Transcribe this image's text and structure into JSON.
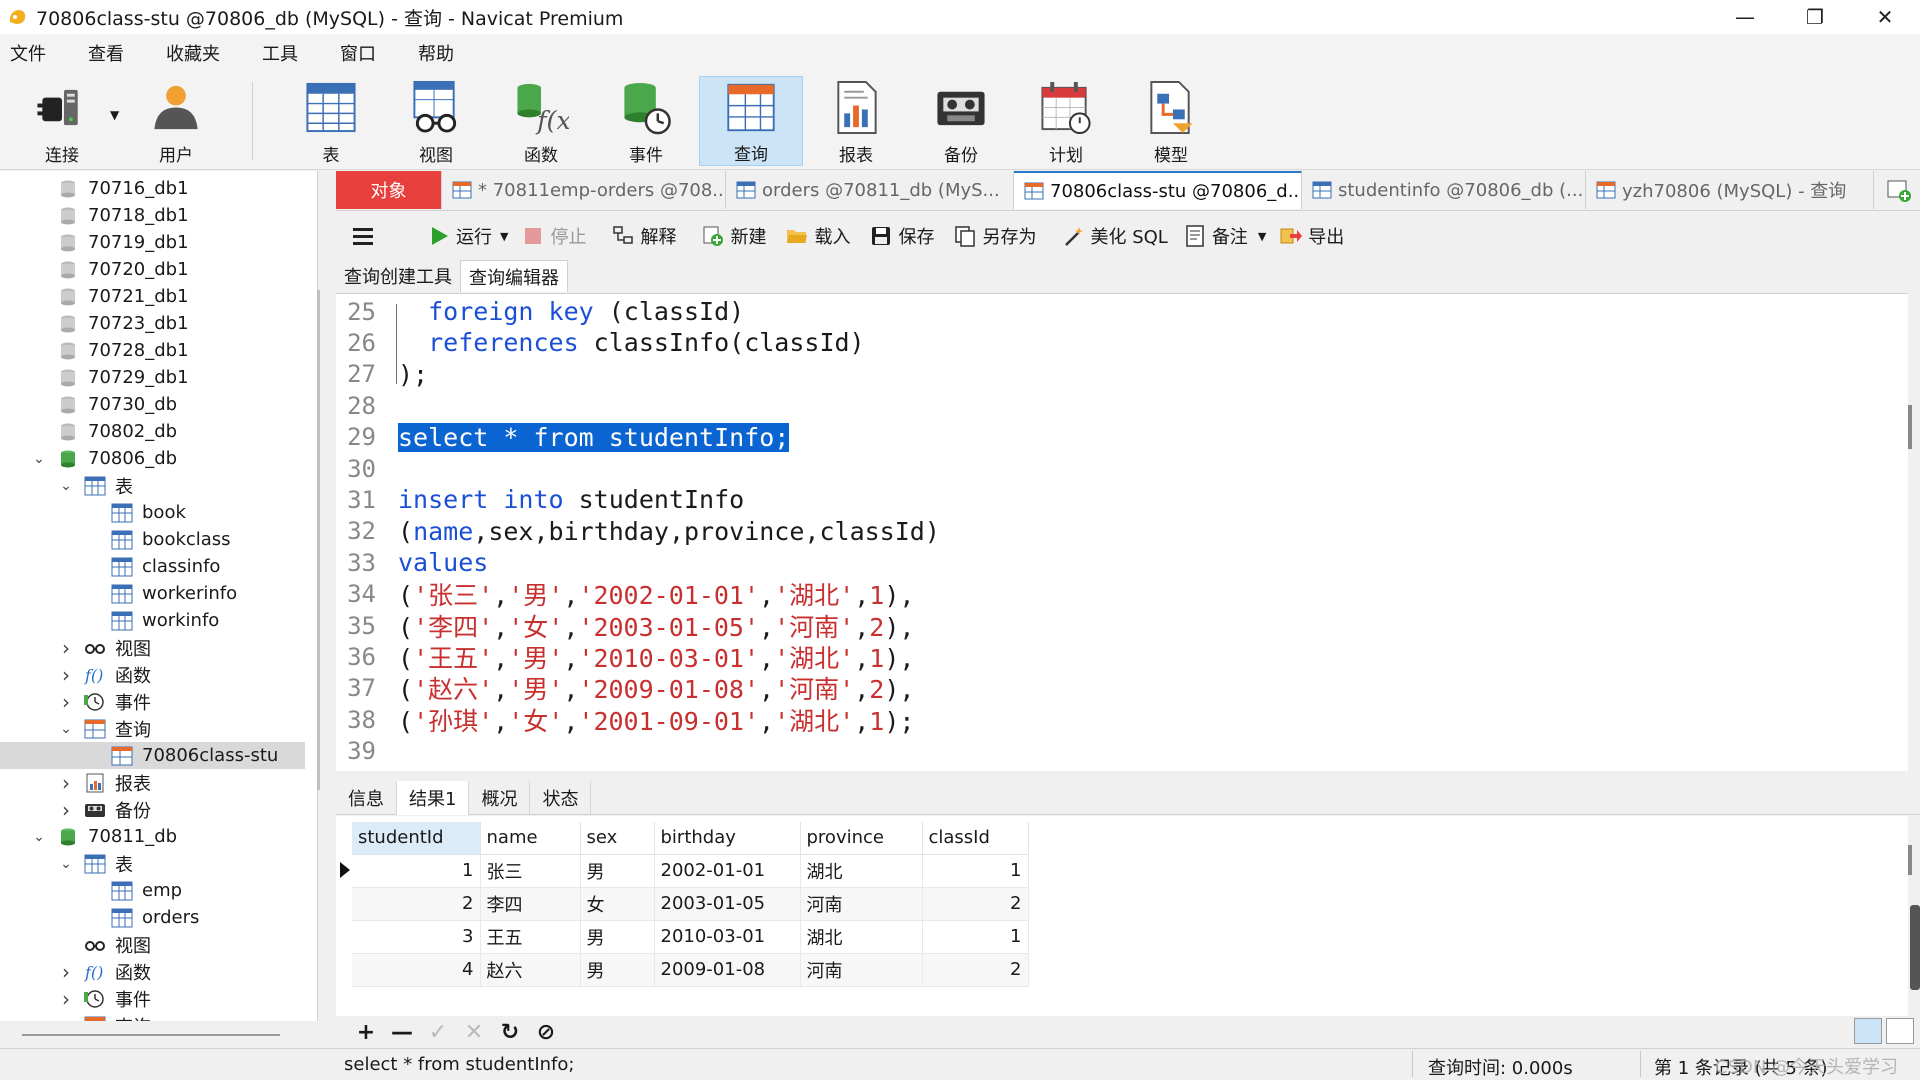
{
  "window": {
    "title": "70806class-stu @70806_db (MySQL) - 查询 - Navicat Premium",
    "minimize": "—",
    "restore": "❐",
    "close": "✕"
  },
  "menu": [
    "文件",
    "查看",
    "收藏夹",
    "工具",
    "窗口",
    "帮助"
  ],
  "toolbar": {
    "connect": "连接",
    "user": "用户",
    "table": "表",
    "view": "视图",
    "function": "函数",
    "event": "事件",
    "query": "查询",
    "report": "报表",
    "backup": "备份",
    "schedule": "计划",
    "model": "模型"
  },
  "tree": [
    {
      "label": "70716_db1",
      "type": "db",
      "level": 0,
      "chev": ""
    },
    {
      "label": "70718_db1",
      "type": "db",
      "level": 0,
      "chev": ""
    },
    {
      "label": "70719_db1",
      "type": "db",
      "level": 0,
      "chev": ""
    },
    {
      "label": "70720_db1",
      "type": "db",
      "level": 0,
      "chev": ""
    },
    {
      "label": "70721_db1",
      "type": "db",
      "level": 0,
      "chev": ""
    },
    {
      "label": "70723_db1",
      "type": "db",
      "level": 0,
      "chev": ""
    },
    {
      "label": "70728_db1",
      "type": "db",
      "level": 0,
      "chev": ""
    },
    {
      "label": "70729_db1",
      "type": "db",
      "level": 0,
      "chev": ""
    },
    {
      "label": "70730_db",
      "type": "db",
      "level": 0,
      "chev": ""
    },
    {
      "label": "70802_db",
      "type": "db",
      "level": 0,
      "chev": ""
    },
    {
      "label": "70806_db",
      "type": "dbopen",
      "level": 0,
      "chev": "v"
    },
    {
      "label": "表",
      "type": "tables",
      "level": 1,
      "chev": "v"
    },
    {
      "label": "book",
      "type": "table",
      "level": 2,
      "chev": ""
    },
    {
      "label": "bookclass",
      "type": "table",
      "level": 2,
      "chev": ""
    },
    {
      "label": "classinfo",
      "type": "table",
      "level": 2,
      "chev": ""
    },
    {
      "label": "workerinfo",
      "type": "table",
      "level": 2,
      "chev": ""
    },
    {
      "label": "workinfo",
      "type": "table",
      "level": 2,
      "chev": ""
    },
    {
      "label": "视图",
      "type": "view",
      "level": 1,
      "chev": ">"
    },
    {
      "label": "函数",
      "type": "func",
      "level": 1,
      "chev": ">"
    },
    {
      "label": "事件",
      "type": "event",
      "level": 1,
      "chev": ">"
    },
    {
      "label": "查询",
      "type": "query",
      "level": 1,
      "chev": "v"
    },
    {
      "label": "70806class-stu",
      "type": "queryitem",
      "level": 2,
      "chev": "",
      "selected": true
    },
    {
      "label": "报表",
      "type": "report",
      "level": 1,
      "chev": ">"
    },
    {
      "label": "备份",
      "type": "backup",
      "level": 1,
      "chev": ">"
    },
    {
      "label": "70811_db",
      "type": "dbopen",
      "level": 0,
      "chev": "v"
    },
    {
      "label": "表",
      "type": "tables",
      "level": 1,
      "chev": "v"
    },
    {
      "label": "emp",
      "type": "table",
      "level": 2,
      "chev": ""
    },
    {
      "label": "orders",
      "type": "table",
      "level": 2,
      "chev": ""
    },
    {
      "label": "视图",
      "type": "view",
      "level": 1,
      "chev": ""
    },
    {
      "label": "函数",
      "type": "func",
      "level": 1,
      "chev": ">"
    },
    {
      "label": "事件",
      "type": "event",
      "level": 1,
      "chev": ">"
    },
    {
      "label": "查询",
      "type": "query",
      "level": 1,
      "chev": "v"
    }
  ],
  "tabs": {
    "objects": "对象",
    "items": [
      {
        "label": "* 70811emp-orders @708...",
        "kind": "query"
      },
      {
        "label": "orders @70811_db (MyS...",
        "kind": "table"
      },
      {
        "label": "70806class-stu @70806_d...",
        "kind": "query",
        "active": true
      },
      {
        "label": "studentinfo @70806_db (...",
        "kind": "table"
      },
      {
        "label": "yzh70806 (MySQL) - 查询",
        "kind": "query"
      }
    ]
  },
  "query_toolbar": {
    "run": "运行",
    "stop": "停止",
    "explain": "解释",
    "new": "新建",
    "load": "载入",
    "save": "保存",
    "save_as": "另存为",
    "beautify": "美化 SQL",
    "comment": "备注",
    "export": "导出"
  },
  "subtabs": [
    "查询创建工具",
    "查询编辑器"
  ],
  "editor": {
    "lines": [
      {
        "n": "25",
        "tokens": [
          [
            "  ",
            ""
          ],
          [
            "foreign key",
            "kw"
          ],
          [
            " (classId)",
            ""
          ]
        ]
      },
      {
        "n": "26",
        "tokens": [
          [
            "  ",
            ""
          ],
          [
            "references",
            "kw"
          ],
          [
            " classInfo(classId)",
            ""
          ]
        ]
      },
      {
        "n": "27",
        "tokens": [
          [
            ");",
            ""
          ]
        ]
      },
      {
        "n": "28",
        "tokens": []
      },
      {
        "n": "29",
        "tokens": [
          [
            "select * from studentInfo;",
            "sel"
          ]
        ]
      },
      {
        "n": "30",
        "tokens": []
      },
      {
        "n": "31",
        "tokens": [
          [
            "insert into",
            "kw"
          ],
          [
            " studentInfo",
            ""
          ]
        ]
      },
      {
        "n": "32",
        "tokens": [
          [
            "(",
            ""
          ],
          [
            "name",
            "kw"
          ],
          [
            ",sex,birthday,province,classId)",
            ""
          ]
        ]
      },
      {
        "n": "33",
        "tokens": [
          [
            "values",
            "kw"
          ]
        ]
      },
      {
        "n": "34",
        "tokens": [
          [
            "(",
            ""
          ],
          [
            "'张三'",
            "str"
          ],
          [
            ",",
            ""
          ],
          [
            "'男'",
            "str"
          ],
          [
            ",",
            ""
          ],
          [
            "'2002-01-01'",
            "str"
          ],
          [
            ",",
            ""
          ],
          [
            "'湖北'",
            "str"
          ],
          [
            ",",
            ""
          ],
          [
            "1",
            "num"
          ],
          [
            "),",
            ""
          ]
        ]
      },
      {
        "n": "35",
        "tokens": [
          [
            "(",
            ""
          ],
          [
            "'李四'",
            "str"
          ],
          [
            ",",
            ""
          ],
          [
            "'女'",
            "str"
          ],
          [
            ",",
            ""
          ],
          [
            "'2003-01-05'",
            "str"
          ],
          [
            ",",
            ""
          ],
          [
            "'河南'",
            "str"
          ],
          [
            ",",
            ""
          ],
          [
            "2",
            "num"
          ],
          [
            "),",
            ""
          ]
        ]
      },
      {
        "n": "36",
        "tokens": [
          [
            "(",
            ""
          ],
          [
            "'王五'",
            "str"
          ],
          [
            ",",
            ""
          ],
          [
            "'男'",
            "str"
          ],
          [
            ",",
            ""
          ],
          [
            "'2010-03-01'",
            "str"
          ],
          [
            ",",
            ""
          ],
          [
            "'湖北'",
            "str"
          ],
          [
            ",",
            ""
          ],
          [
            "1",
            "num"
          ],
          [
            "),",
            ""
          ]
        ]
      },
      {
        "n": "37",
        "tokens": [
          [
            "(",
            ""
          ],
          [
            "'赵六'",
            "str"
          ],
          [
            ",",
            ""
          ],
          [
            "'男'",
            "str"
          ],
          [
            ",",
            ""
          ],
          [
            "'2009-01-08'",
            "str"
          ],
          [
            ",",
            ""
          ],
          [
            "'河南'",
            "str"
          ],
          [
            ",",
            ""
          ],
          [
            "2",
            "num"
          ],
          [
            "),",
            ""
          ]
        ]
      },
      {
        "n": "38",
        "tokens": [
          [
            "(",
            ""
          ],
          [
            "'孙琪'",
            "str"
          ],
          [
            ",",
            ""
          ],
          [
            "'女'",
            "str"
          ],
          [
            ",",
            ""
          ],
          [
            "'2001-09-01'",
            "str"
          ],
          [
            ",",
            ""
          ],
          [
            "'湖北'",
            "str"
          ],
          [
            ",",
            ""
          ],
          [
            "1",
            "num"
          ],
          [
            ");",
            ""
          ]
        ]
      },
      {
        "n": "39",
        "tokens": []
      }
    ]
  },
  "result_tabs": [
    "信息",
    "结果1",
    "概况",
    "状态"
  ],
  "result": {
    "columns": [
      "studentId",
      "name",
      "sex",
      "birthday",
      "province",
      "classId"
    ],
    "rows": [
      [
        "1",
        "张三",
        "男",
        "2002-01-01",
        "湖北",
        "1"
      ],
      [
        "2",
        "李四",
        "女",
        "2003-01-05",
        "河南",
        "2"
      ],
      [
        "3",
        "王五",
        "男",
        "2010-03-01",
        "湖北",
        "1"
      ],
      [
        "4",
        "赵六",
        "男",
        "2009-01-08",
        "河南",
        "2"
      ]
    ]
  },
  "grid_tools": [
    "+",
    "—",
    "✓",
    "✕",
    "↻",
    "⊘"
  ],
  "status": {
    "sql": "select * from studentInfo;",
    "query_time": "查询时间: 0.000s",
    "records": "第 1 条记录 (共 5 条)",
    "watermark": "CSDN @今天头爱学习"
  },
  "colors": {
    "accent": "#2a78c8",
    "objects_tab": "#e8403c",
    "selection": "#0a64d2",
    "keyword": "#1a4fd6",
    "string": "#c83030"
  }
}
